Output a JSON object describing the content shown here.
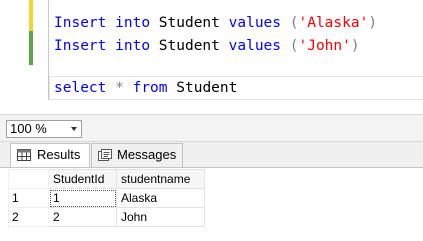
{
  "editor": {
    "lines": [
      {
        "kw1": "Insert",
        "kw2": "into",
        "table": "Student",
        "kw3": "values",
        "open": "(",
        "value": "'Alaska'",
        "close": ")"
      },
      {
        "kw1": "Insert",
        "kw2": "into",
        "table": "Student",
        "kw3": "values",
        "open": "(",
        "value": "'John'",
        "close": ")"
      }
    ],
    "query": {
      "kw1": "select",
      "star": "*",
      "kw2": "from",
      "table": "Student"
    },
    "colors": {
      "keyword": "#0000ff",
      "string": "#ff0000",
      "operator": "#808080"
    }
  },
  "zoom": {
    "value": "100 %"
  },
  "tabs": {
    "results": {
      "label": "Results",
      "icon": "grid-icon"
    },
    "messages": {
      "label": "Messages",
      "icon": "messages-icon"
    }
  },
  "grid": {
    "columns": [
      "StudentId",
      "studentname"
    ],
    "rows": [
      {
        "num": "1",
        "cells": [
          "1",
          "Alaska"
        ]
      },
      {
        "num": "2",
        "cells": [
          "2",
          "John"
        ]
      }
    ]
  }
}
